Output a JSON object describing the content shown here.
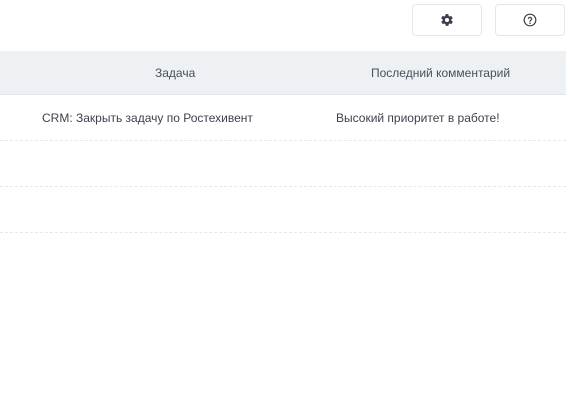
{
  "toolbar": {
    "buttons": [
      {
        "icon": "gear-icon",
        "label": ""
      },
      {
        "icon": "question-circle-icon",
        "label": ""
      }
    ]
  },
  "table": {
    "columns": [
      "Задача",
      "Последний комментарий"
    ],
    "rows": [
      {
        "task": "CRM: Закрыть задачу по Ростехивент",
        "comment": "Высокий приоритет в работе!"
      },
      {
        "task": "",
        "comment": ""
      },
      {
        "task": "",
        "comment": ""
      }
    ]
  },
  "colors": {
    "header_bg": "#eef1f4",
    "row_divider": "#e6e9ec",
    "text": "#3d424c",
    "button_border": "#e3e6ea"
  }
}
